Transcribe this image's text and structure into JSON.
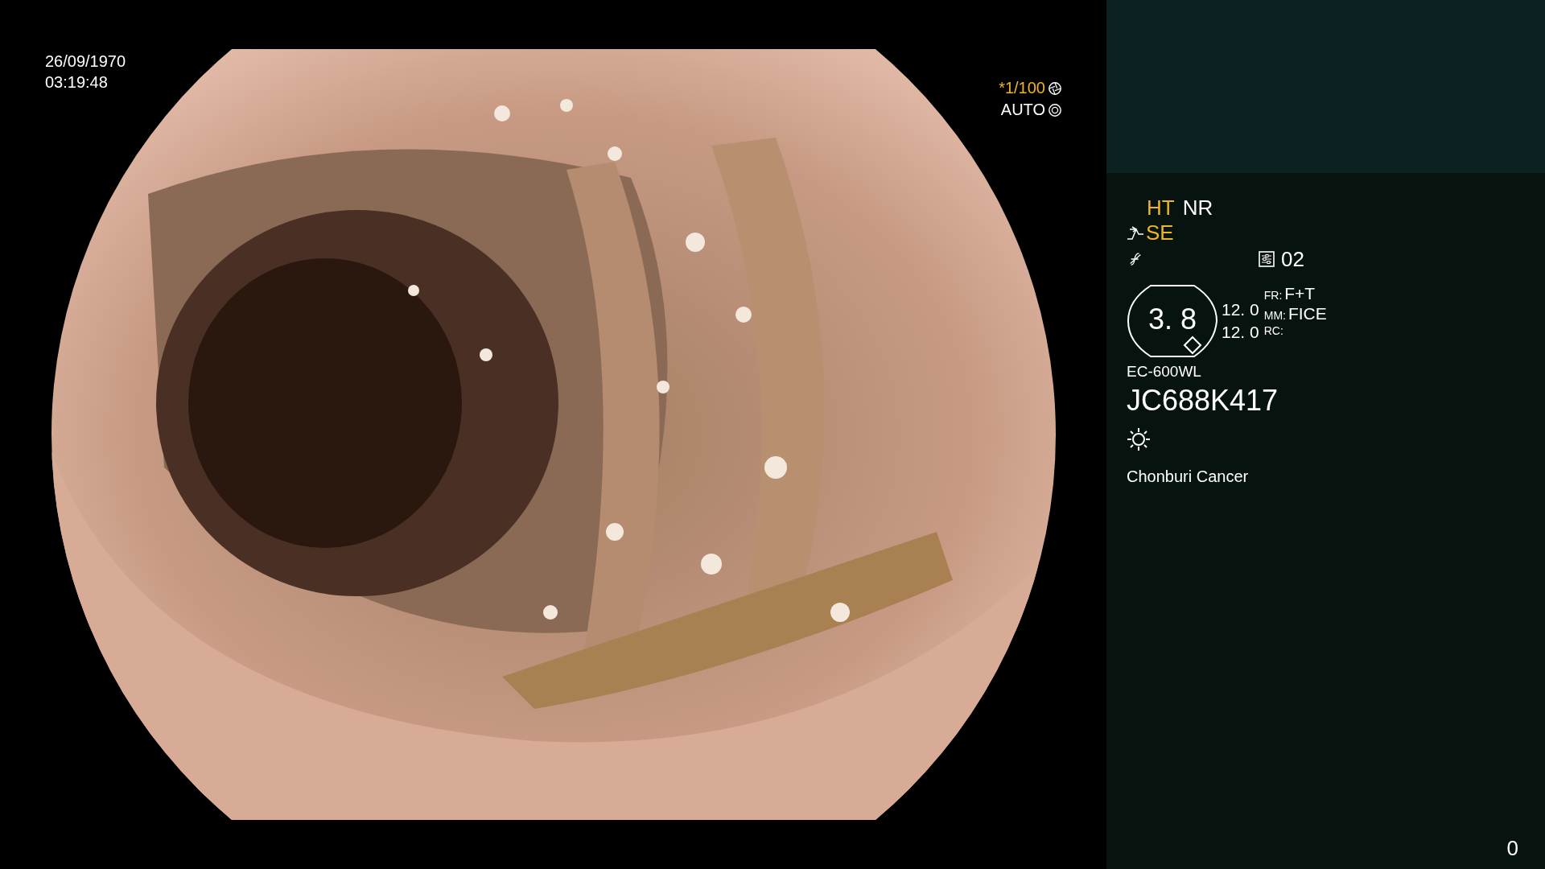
{
  "timestamp": {
    "date": "26/09/1970",
    "time": "03:19:48"
  },
  "shutter": {
    "speed": "*1/100",
    "mode": "AUTO"
  },
  "enhancements": [
    {
      "label": "HT",
      "color": "#f0b428"
    },
    {
      "label": "NR",
      "color": "#ffffff"
    }
  ],
  "structure": {
    "label": "SE",
    "color": "#f0b428"
  },
  "preset": "02",
  "zoom": {
    "value": "3. 8",
    "upper": "12. 0",
    "lower": "12. 0"
  },
  "params": [
    {
      "key": "FR:",
      "value": "F+T"
    },
    {
      "key": "MM:",
      "value": "FICE"
    },
    {
      "key": "RC:"
    }
  ],
  "scope_model": "EC-600WL",
  "serial": "JC688K417",
  "institution": "Chonburi Cancer",
  "counter": "0"
}
